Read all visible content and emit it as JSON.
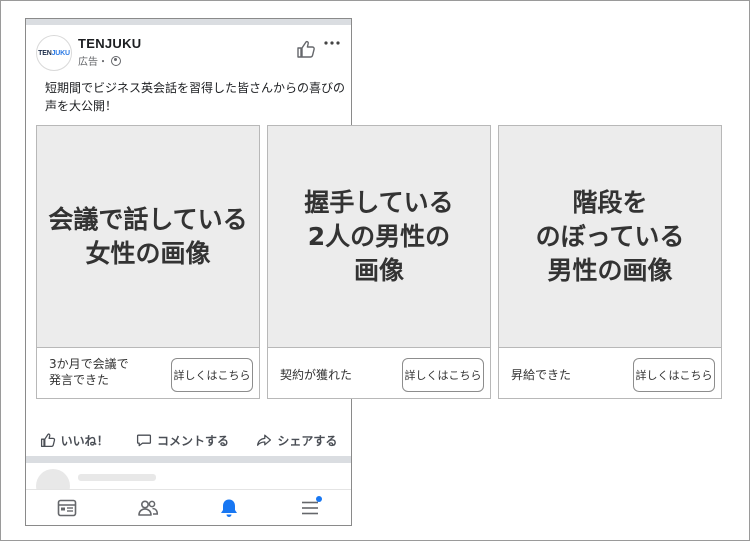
{
  "post": {
    "brand_name": "TENJUKU",
    "avatar_text_a": "TEN",
    "avatar_text_b": "JUKU",
    "meta_label": "広告・",
    "body_text": "短期間でビジネス英会話を習得した皆さんからの喜びの声を大公開！"
  },
  "cards": [
    {
      "image_text": "会議で話している\n女性の画像",
      "caption": "3か月で会議で\n発言できた",
      "button_label": "詳しくはこちら"
    },
    {
      "image_text": "握手している\n2人の男性の\n画像",
      "caption": "契約が獲れた",
      "button_label": "詳しくはこちら"
    },
    {
      "image_text": "階段を\nのぼっている\n男性の画像",
      "caption": "昇給できた",
      "button_label": "詳しくはこちら"
    }
  ],
  "actions": {
    "like_label": "いいね！",
    "comment_label": "コメントする",
    "share_label": "シェアする"
  },
  "icons": {
    "like": "thumbs-up-icon",
    "more": "more-dots-icon",
    "globe": "globe-icon",
    "comment": "comment-icon",
    "share": "share-icon",
    "nav": [
      "feed-icon",
      "friends-icon",
      "bell-icon",
      "menu-icon"
    ]
  },
  "colors": {
    "accent": "#1877f2",
    "image_placeholder": "#ececec"
  }
}
